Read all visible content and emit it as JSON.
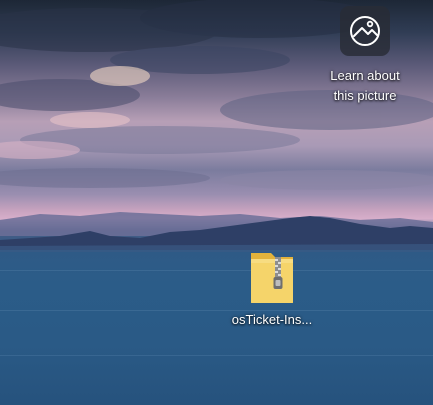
{
  "desktop": {
    "learn_about_picture": {
      "label": "Learn about\nthis picture",
      "icon": "camera-aperture-icon"
    },
    "file": {
      "label": "osTicket-Ins...",
      "icon": "zip-folder-icon"
    }
  },
  "colors": {
    "sky_dark": "#1d2736",
    "sky_pink": "#d7aeca",
    "sea_blue": "#2b5c88",
    "mountain": "#2e3f66",
    "folder_yellow": "#f2c94c"
  }
}
